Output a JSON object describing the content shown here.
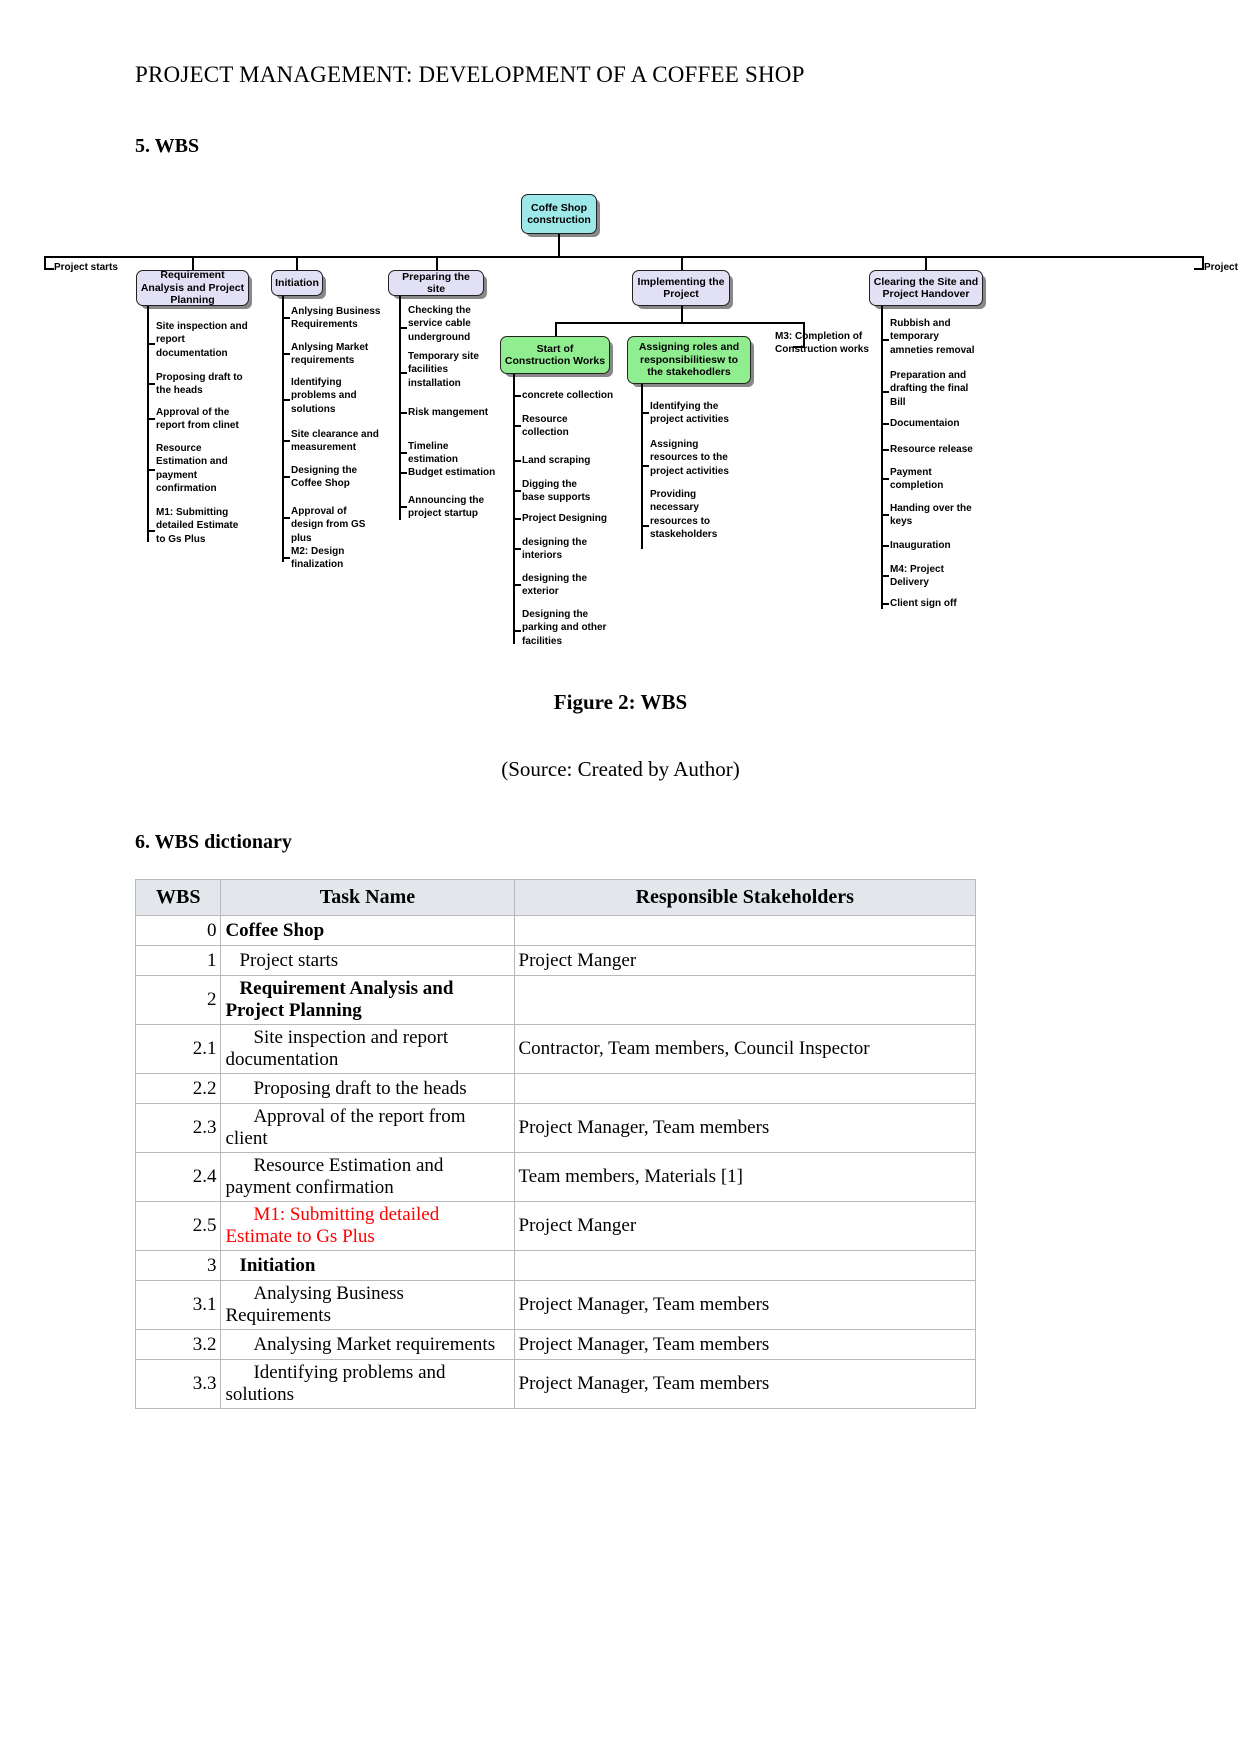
{
  "document": {
    "running_header": "PROJECT MANAGEMENT: DEVELOPMENT OF A COFFEE SHOP",
    "section_wbs": "5. WBS",
    "section_dictionary": "6. WBS dictionary",
    "figure_caption": "Figure 2: WBS",
    "figure_source": "(Source: Created by Author)"
  },
  "wbs_diagram": {
    "root": "Coffe Shop construction",
    "start_label": "Project starts",
    "end_label": "Project ends",
    "milestone_m3": "M3: Completion of Construction works",
    "branches": [
      {
        "title": "Requirement Analysis and Project Planning",
        "color": "#e2e0f5",
        "children": [
          "Site inspection and report documentation",
          "Proposing draft to the heads",
          "Approval of the report from clinet",
          "Resource Estimation and payment confirmation",
          "M1: Submitting detailed Estimate to Gs Plus"
        ]
      },
      {
        "title": "Initiation",
        "color": "#e2e0f5",
        "children": [
          "Anlysing Business Requirements",
          "Anlysing Market requirements",
          "Identifying problems and solutions",
          "Site clearance and measurement",
          "Designing the Coffee Shop",
          "Approval of design from GS plus",
          "M2: Design finalization"
        ]
      },
      {
        "title": "Preparing the site",
        "color": "#e2e0f5",
        "children": [
          "Checking the service cable underground",
          "Temporary site facilities installation",
          "Risk mangement",
          "Timeline estimation",
          "Budget estimation",
          "Announcing the project startup"
        ]
      },
      {
        "title": "Implementing the Project",
        "color": "#e2e0f5",
        "children": []
      },
      {
        "title": "Start of Construction Works",
        "color": "#90ee90",
        "children": [
          "concrete collection",
          "Resource collection",
          "Land scraping",
          "Digging the base supports",
          "Project Designing",
          "designing the interiors",
          "designing the exterior",
          "Designing the parking and other facilities"
        ]
      },
      {
        "title": "Assigning roles and responsibilitiesw to the stakehodlers",
        "color": "#90ee90",
        "children": [
          "Identifying the project activities",
          "Assigning resources to the project activities",
          "Providing necessary resources to staskeholders"
        ]
      },
      {
        "title": "Clearing the Site and Project Handover",
        "color": "#e2e0f5",
        "children": [
          "Rubbish and temporary amneties removal",
          "Preparation and drafting the final Bill",
          "Documentaion",
          "Resource release",
          "Payment completion",
          "Handing over the keys",
          "Inauguration",
          "M4: Project Delivery",
          "Client sign off"
        ]
      }
    ]
  },
  "dictionary_table": {
    "columns": [
      "WBS",
      "Task Name",
      "Responsible Stakeholders"
    ],
    "rows": [
      {
        "wbs": "0",
        "task": "Coffee Shop",
        "stake": "",
        "style": "lvl0"
      },
      {
        "wbs": "1",
        "task": "Project starts",
        "stake": "Project Manger",
        "style": "lvl1"
      },
      {
        "wbs": "2",
        "task": "Requirement Analysis and Project Planning",
        "stake": "",
        "style": "lvl1b"
      },
      {
        "wbs": "2.1",
        "task": "Site inspection and report documentation",
        "stake": "Contractor, Team members, Council Inspector",
        "style": "lvl2"
      },
      {
        "wbs": "2.2",
        "task": "Proposing draft to the heads",
        "stake": "",
        "style": "lvl2"
      },
      {
        "wbs": "2.3",
        "task": "Approval of the report from client",
        "stake": "Project Manager, Team members",
        "style": "lvl2"
      },
      {
        "wbs": "2.4",
        "task": "Resource Estimation and payment confirmation",
        "stake": "Team members, Materials [1]",
        "style": "lvl2"
      },
      {
        "wbs": "2.5",
        "task": "M1: Submitting detailed Estimate to Gs Plus",
        "stake": "Project Manger",
        "style": "lvl2",
        "milestone": true
      },
      {
        "wbs": "3",
        "task": "Initiation",
        "stake": "",
        "style": "lvl1b"
      },
      {
        "wbs": "3.1",
        "task": "Analysing Business Requirements",
        "stake": "Project Manager, Team members",
        "style": "lvl2"
      },
      {
        "wbs": "3.2",
        "task": "Analysing Market requirements",
        "stake": "Project Manager, Team members",
        "style": "lvl2"
      },
      {
        "wbs": "3.3",
        "task": "Identifying problems and solutions",
        "stake": "Project Manager, Team members",
        "style": "lvl2"
      }
    ]
  }
}
